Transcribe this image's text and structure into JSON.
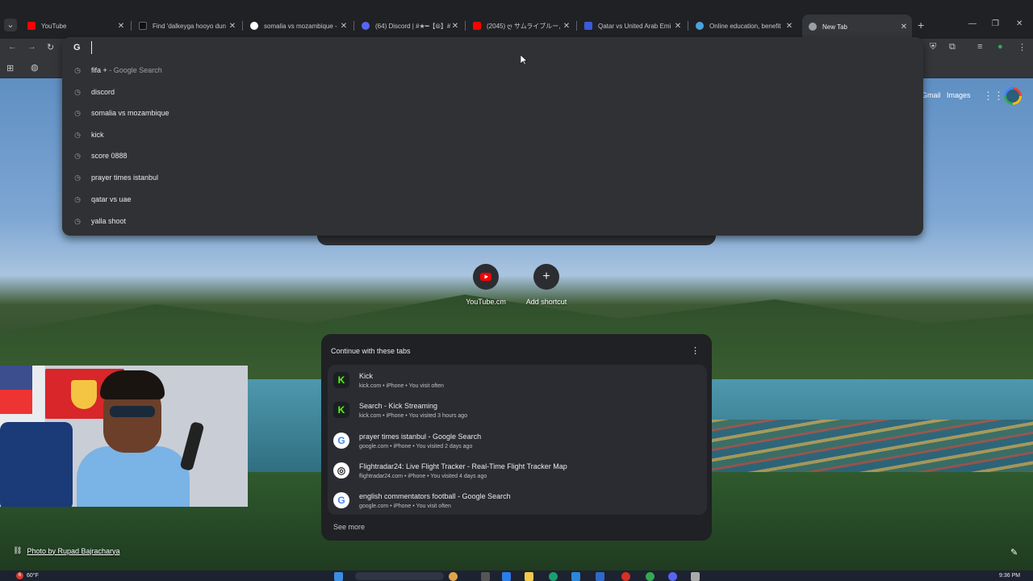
{
  "tabs": [
    {
      "title": "YouTube",
      "favicon": "youtube-icon",
      "color": "#ff0000"
    },
    {
      "title": "Find 'dalkeyga hooyo dun",
      "favicon": "tiktok-icon",
      "color": "#111111"
    },
    {
      "title": "somalia vs mozambique -",
      "favicon": "google-icon",
      "color": "#4285f4"
    },
    {
      "title": "(64) Discord | #★━【⦾】#",
      "favicon": "discord-icon",
      "color": "#5865f2"
    },
    {
      "title": "(2045) ღ サムライブルー, 圧",
      "favicon": "youtube-icon",
      "color": "#ff0000"
    },
    {
      "title": "Qatar vs United Arab Emi",
      "favicon": "site-icon",
      "color": "#3b5bdb"
    },
    {
      "title": "Online education, benefit",
      "favicon": "wordpress-icon",
      "color": "#4aa3df"
    },
    {
      "title": "New Tab",
      "favicon": "chrome-icon",
      "color": "#9aa0a6"
    }
  ],
  "omnibox": {
    "value": "",
    "placeholder": "",
    "suggestions": [
      {
        "text": "fifa +",
        "sub": " - Google Search"
      },
      {
        "text": "discord",
        "sub": ""
      },
      {
        "text": "somalia vs mozambique",
        "sub": ""
      },
      {
        "text": "kick",
        "sub": ""
      },
      {
        "text": "score 0888",
        "sub": ""
      },
      {
        "text": "prayer times istanbul",
        "sub": ""
      },
      {
        "text": "qatar vs uae",
        "sub": ""
      },
      {
        "text": "yalla shoot",
        "sub": ""
      }
    ]
  },
  "header_links": {
    "gmail": "Gmail",
    "images": "Images"
  },
  "shortcuts": [
    {
      "label": "YouTube.cm",
      "icon": "youtube-icon"
    },
    {
      "label": "Add shortcut",
      "icon": "plus-icon"
    }
  ],
  "continue_card": {
    "title": "Continue with these tabs",
    "items": [
      {
        "title": "Kick",
        "sub": "kick.com • iPhone • You visit often",
        "icon": "kick-icon",
        "glyph": "K",
        "bg": "#53fc18",
        "fg": "#111"
      },
      {
        "title": "Search - Kick Streaming",
        "sub": "kick.com • iPhone • You visited 3 hours ago",
        "icon": "kick-icon",
        "glyph": "K",
        "bg": "#53fc18",
        "fg": "#111"
      },
      {
        "title": "prayer times istanbul - Google Search",
        "sub": "google.com • iPhone • You visited 2 days ago",
        "icon": "google-icon",
        "glyph": "G",
        "bg": "#ffffff",
        "fg": "#4285f4"
      },
      {
        "title": "Flightradar24: Live Flight Tracker - Real-Time Flight Tracker Map",
        "sub": "flightradar24.com • iPhone • You visited 4 days ago",
        "icon": "flightradar-icon",
        "glyph": "◎",
        "bg": "#ffffff",
        "fg": "#222"
      },
      {
        "title": "english commentators football - Google Search",
        "sub": "google.com • iPhone • You visit often",
        "icon": "google-icon",
        "glyph": "G",
        "bg": "#ffffff",
        "fg": "#4285f4"
      }
    ],
    "see_more": "See more"
  },
  "photo_credit": "Photo by Rupad Bajracharya",
  "taskbar": {
    "weather": "60°F",
    "badge": "6",
    "time": "9:36 PM"
  }
}
